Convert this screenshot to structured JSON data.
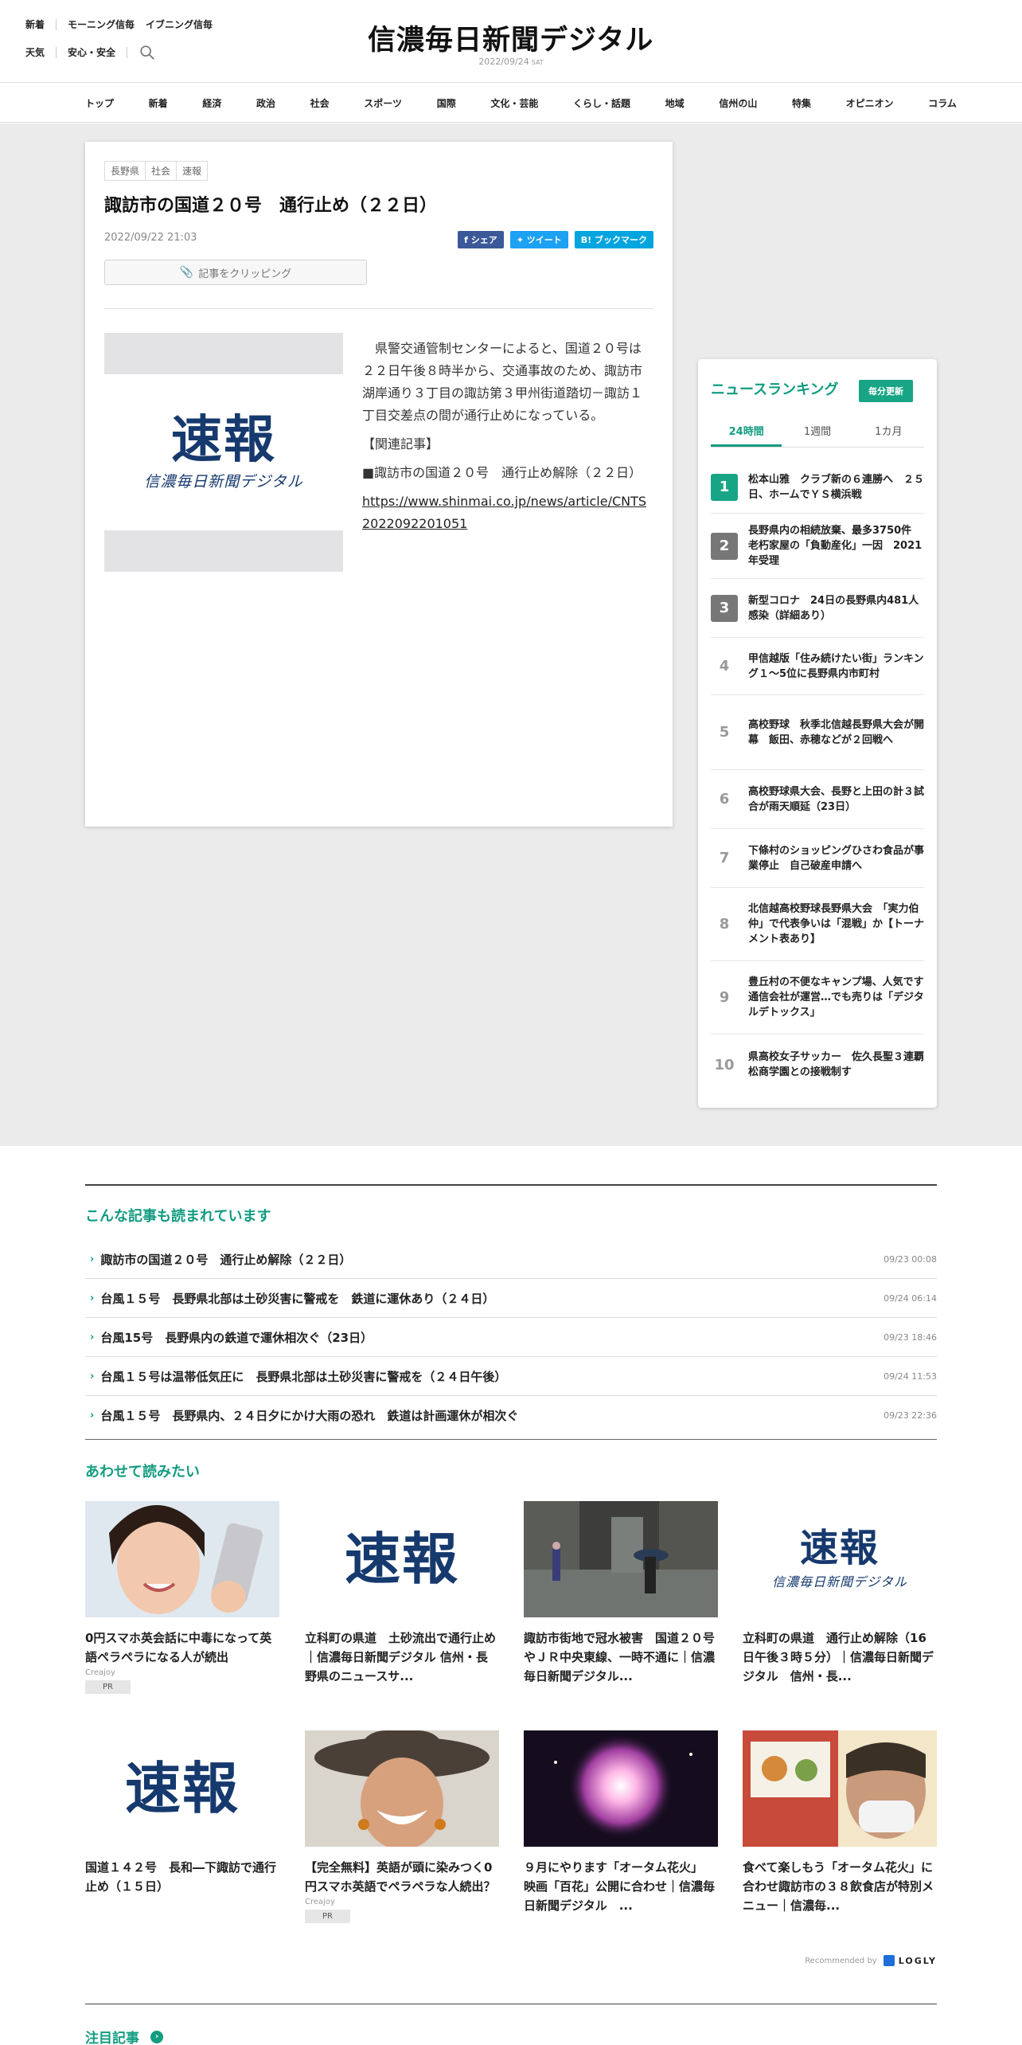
{
  "header": {
    "links_row1": [
      "新着",
      "モーニング信毎",
      "イブニング信毎"
    ],
    "links_row2": [
      "天気",
      "安心・安全"
    ],
    "logo": "信濃毎日新聞デジタル",
    "date": "2022/09/24",
    "dow": "SAT"
  },
  "nav": [
    "トップ",
    "新着",
    "経済",
    "政治",
    "社会",
    "スポーツ",
    "国際",
    "文化・芸能",
    "くらし・話題",
    "地域",
    "信州の山",
    "特集",
    "オピニオン",
    "コラム"
  ],
  "article": {
    "tags": [
      "長野県",
      "社会",
      "速報"
    ],
    "title": "諏訪市の国道２０号　通行止め（２２日）",
    "date": "2022/09/22 21:03",
    "share": {
      "facebook": "シェア",
      "twitter": "ツイート",
      "hatena": "B! ブックマーク"
    },
    "clip_label": "記事をクリッピング",
    "photo": {
      "main": "速報",
      "sub": "信濃毎日新聞デジタル"
    },
    "body": [
      "　県警交通管制センターによると、国道２０号は２２日午後８時半から、交通事故のため、諏訪市湖岸通り３丁目の諏訪第３甲州街道踏切－諏訪１丁目交差点の間が通行止めになっている。",
      "【関連記事】",
      "■諏訪市の国道２０号　通行止め解除（２２日）"
    ],
    "link": "https://www.shinmai.co.jp/news/article/CNTS2022092201051"
  },
  "ranking": {
    "title": "ニュースランキング",
    "badge": "毎分更新",
    "tabs": [
      "24時間",
      "1週間",
      "1カ月"
    ],
    "items": [
      {
        "rank": "1",
        "text": "松本山雅　クラブ新の６連勝へ　２５日、ホームでＹＳ横浜戦"
      },
      {
        "rank": "2",
        "text": "長野県内の相続放棄、最多3750件　老朽家屋の「負動産化」一因　2021年受理"
      },
      {
        "rank": "3",
        "text": "新型コロナ　24日の長野県内481人感染（詳細あり）"
      },
      {
        "rank": "4",
        "text": "甲信越版「住み続けたい街」ランキング１～5位に長野県内市町村"
      },
      {
        "rank": "5",
        "text": "高校野球　秋季北信越長野県大会が開幕　飯田、赤穂などが２回戦へ"
      },
      {
        "rank": "6",
        "text": "高校野球県大会、長野と上田の計３試合が雨天順延（23日）"
      },
      {
        "rank": "7",
        "text": "下條村のショッピングひさわ食品が事業停止　自己破産申請へ"
      },
      {
        "rank": "8",
        "text": "北信越高校野球長野県大会　「実力伯仲」で代表争いは「混戦」か【トーナメント表あり】"
      },
      {
        "rank": "9",
        "text": "豊丘村の不便なキャンプ場、人気です　通信会社が運営…でも売りは「デジタルデトックス」"
      },
      {
        "rank": "10",
        "text": "県高校女子サッカー　佐久長聖３連覇　松商学園との接戦制す"
      }
    ]
  },
  "related": {
    "title": "こんな記事も読まれています",
    "items": [
      {
        "text": "諏訪市の国道２０号　通行止め解除（２２日）",
        "time": "09/23 00:08"
      },
      {
        "text": "台風１５号　長野県北部は土砂災害に警戒を　鉄道に運休あり（２４日）",
        "time": "09/24 06:14"
      },
      {
        "text": "台風15号　長野県内の鉄道で運休相次ぐ（23日）",
        "time": "09/23 18:46"
      },
      {
        "text": "台風１５号は温帯低気圧に　長野県北部は土砂災害に警戒を（２４日午後）",
        "time": "09/24 11:53"
      },
      {
        "text": "台風１５号　長野県内、２４日夕にかけ大雨の恐れ　鉄道は計画運休が相次ぐ",
        "time": "09/23 22:36"
      }
    ]
  },
  "recommend": {
    "title": "あわせて読みたい",
    "cards": [
      {
        "title": "0円スマホ英会話に中毒になって英語ペラペラになる人が続出",
        "source": "Creajoy",
        "pr": "PR"
      },
      {
        "title": "立科町の県道　土砂流出で通行止め｜信濃毎日新聞デジタル 信州・長野県のニュースサ...",
        "thumb_main": "速報"
      },
      {
        "title": "諏訪市街地で冠水被害　国道２０号やＪＲ中央東線、一時不通に｜信濃毎日新聞デジタル..."
      },
      {
        "title": "立科町の県道　通行止め解除（16日午後３時５分）｜信濃毎日新聞デジタル　信州・長...",
        "thumb_main": "速報",
        "thumb_sub": "信濃毎日新聞デジタル"
      },
      {
        "title": "国道１４２号　長和―下諏訪で通行止め（１５日）",
        "thumb_main": "速報"
      },
      {
        "title": "【完全無料】英語が頭に染みつく0円スマホ英語でペラペラな人続出？",
        "source": "Creajoy",
        "pr": "PR"
      },
      {
        "title": "９月にやります「オータム花火」　映画「百花」公開に合わせ｜信濃毎日新聞デジタル　..."
      },
      {
        "title": "食べて楽しもう「オータム花火」に合わせ諏訪市の３８飲食店が特別メニュー｜信濃毎..."
      }
    ],
    "recommended_by": "Recommended by",
    "brand": "LOGLY"
  },
  "notice": {
    "title": "注目記事"
  },
  "colors": {
    "accent": "#129c80",
    "logo_navy": "#16396e",
    "gray_bg": "#ebebeb"
  }
}
